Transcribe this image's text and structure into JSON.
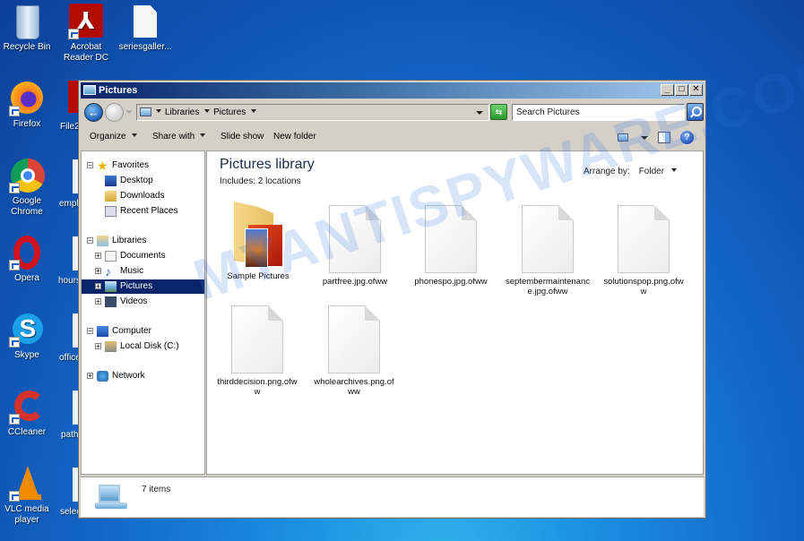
{
  "desktop": {
    "icons": [
      {
        "label": "Recycle Bin",
        "icon": "recycle-bin-icon"
      },
      {
        "label": "Acrobat Reader DC",
        "icon": "acrobat-icon"
      },
      {
        "label": "seriesgaller...",
        "icon": "file-icon"
      },
      {
        "label": "Firefox",
        "icon": "firefox-icon"
      },
      {
        "label": "Google Chrome",
        "icon": "chrome-icon"
      },
      {
        "label": "Opera",
        "icon": "opera-icon"
      },
      {
        "label": "Skype",
        "icon": "skype-icon"
      },
      {
        "label": "CCleaner",
        "icon": "ccleaner-icon"
      },
      {
        "label": "VLC media player",
        "icon": "vlc-icon"
      }
    ],
    "partial_icons": [
      "File2",
      "empl",
      "hours",
      "office",
      "path",
      "selec"
    ]
  },
  "window": {
    "title": "Pictures",
    "address": {
      "crumbs": [
        "Libraries",
        "Pictures"
      ]
    },
    "search_placeholder": "Search Pictures",
    "toolbar": {
      "organize": "Organize",
      "share_with": "Share with",
      "slide_show": "Slide show",
      "new_folder": "New folder"
    },
    "nav": {
      "favorites": "Favorites",
      "desktop": "Desktop",
      "downloads": "Downloads",
      "recent_places": "Recent Places",
      "libraries": "Libraries",
      "documents": "Documents",
      "music": "Music",
      "pictures": "Pictures",
      "videos": "Videos",
      "computer": "Computer",
      "local_disk": "Local Disk (C:)",
      "network": "Network"
    },
    "content": {
      "title": "Pictures library",
      "includes": "Includes:  2 locations",
      "arrange_label": "Arrange by:",
      "arrange_value": "Folder",
      "items": [
        {
          "name": "Sample Pictures",
          "type": "folder"
        },
        {
          "name": "partfree.jpg.ofww",
          "type": "file"
        },
        {
          "name": "phonespo.jpg.ofww",
          "type": "file"
        },
        {
          "name": "septembermaintenance.jpg.ofww",
          "type": "file"
        },
        {
          "name": "solutionspop.png.ofww",
          "type": "file"
        },
        {
          "name": "thirddecision.png.ofww",
          "type": "file"
        },
        {
          "name": "wholearchives.png.ofww",
          "type": "file"
        }
      ]
    },
    "status": {
      "item_count": "7 items"
    }
  },
  "watermark": "MYANTISPYWARE.COM"
}
